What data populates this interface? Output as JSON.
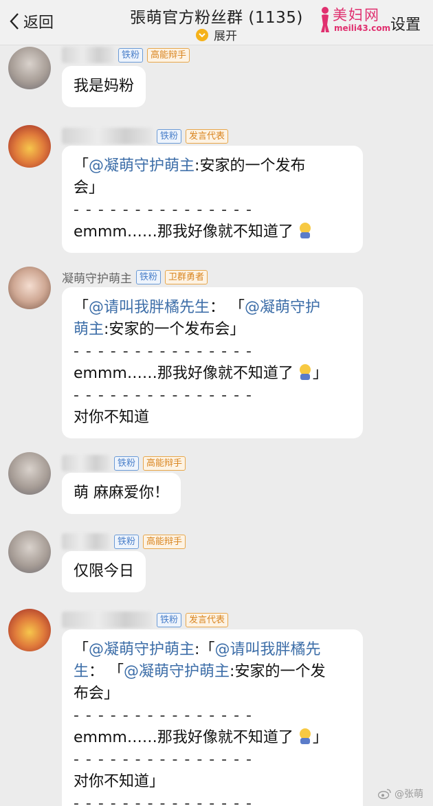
{
  "header": {
    "back_label": "返回",
    "title": "張萌官方粉丝群 (1135)",
    "expand_label": "展开",
    "settings_label": "设置",
    "watermark_top": "美妇网",
    "watermark_bottom": "meili43.com"
  },
  "messages": [
    {
      "badges": [
        "铁粉",
        "高能辩手"
      ],
      "lines": [
        "我是妈粉"
      ]
    },
    {
      "badges": [
        "铁粉",
        "发言代表"
      ],
      "lines": [
        "「@凝萌守护萌主:安家的一个发布",
        "会」",
        "- - - - - - - - - - - - - - -",
        "emmm……那我好像就不知道了"
      ]
    },
    {
      "nick": "凝萌守护萌主",
      "badges": [
        "铁粉",
        "卫群勇者"
      ],
      "lines": [
        "「@请叫我胖橘先生： 「@凝萌守护",
        "萌主:安家的一个发布会」",
        "- - - - - - - - - - - - - - -",
        "emmm……那我好像就不知道了 」",
        "- - - - - - - - - - - - - - -",
        "对你不知道"
      ]
    },
    {
      "badges": [
        "铁粉",
        "高能辩手"
      ],
      "lines": [
        "萌 麻麻爱你！"
      ]
    },
    {
      "badges": [
        "铁粉",
        "高能辩手"
      ],
      "lines": [
        "仅限今日"
      ]
    },
    {
      "badges": [
        "铁粉",
        "发言代表"
      ],
      "lines": [
        "「@凝萌守护萌主:「@请叫我胖橘先",
        "生： 「@凝萌守护萌主:安家的一个发",
        "布会」",
        "- - - - - - - - - - - - - - -",
        "emmm……那我好像就不知道了 」",
        "- - - - - - - - - - - - - - -",
        "对你不知道」",
        "- - - - - - - - - - - - - - -"
      ]
    }
  ],
  "credit": "@张萌"
}
